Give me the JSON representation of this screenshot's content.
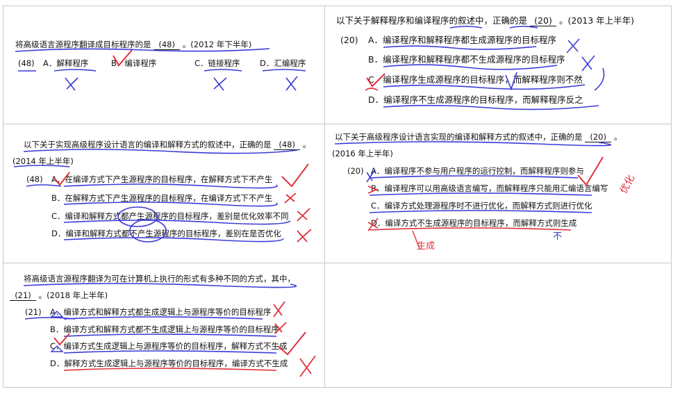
{
  "q1": {
    "stem": "将高级语言源程序翻译成目标程序的是",
    "blank": "(48)",
    "tail": "。(2012 年下半年)",
    "num": "(48)",
    "options": [
      "A．解释程序",
      "B．编译程序",
      "C．链接程序",
      "D．汇编程序"
    ]
  },
  "q2": {
    "stem": "以下关于解释程序和编译程序的叙述中，正确的是",
    "blank": "(20)",
    "tail": "。(2013 年上半年)",
    "num": "(20)",
    "options": [
      "A．编译程序和解释程序都生成源程序的目标程序",
      "B．编译程序和解释程序都不生成源程序的目标程序",
      "C．编译程序生成源程序的目标程序，而解释程序则不然",
      "D．编译程序不生成源程序的目标程序，而解释程序反之"
    ]
  },
  "q3": {
    "stem": "以下关于实现高级程序设计语言的编译和解释方式的叙述中，正确的是",
    "blank": "(48)",
    "tail": "。",
    "year": "(2014 年上半年)",
    "num": "(48)",
    "options": [
      "A．在编译方式下产生源程序的目标程序，在解释方式下不产生",
      "B．在解释方式下产生源程序的目标程序，在编译方式下不产生",
      "C．编译和解释方式都产生源程序的目标程序，差别是优化效率不同",
      "D．编译和解释方式都不产生源程序的目标程序，差别在是否优化"
    ]
  },
  "q4": {
    "stem": "以下关于高级程序设计语言实现的编译和解释方式的叙述中，正确的是",
    "blank": "(20)",
    "tail": "。",
    "year": "(2016 年上半年)",
    "num": "(20)",
    "options": [
      "A．编译程序不参与用户程序的运行控制，而解释程序则参与",
      "B．编译程序可以用高级语言编写，而解释程序只能用汇编语言编写",
      "C．编译方式处理源程序时不进行优化，而解释方式则进行优化",
      "D．编译方式不生成源程序的目标程序，而解释方式则生成"
    ],
    "notes": [
      "优化",
      "生成",
      "不"
    ]
  },
  "q5": {
    "stem": "将高级语言源程序翻译为可在计算机上执行的形式有多种不同的方式，其中，",
    "blank": "(21)",
    "tail": "。(2018 年上半年)",
    "num": "(21)",
    "options": [
      "A．编译方式和解释方式都生成逻辑上与源程序等价的目标程序",
      "B．编译方式和解释方式都不生成逻辑上与源程序等价的目标程序",
      "C．编译方式生成逻辑上与源程序等价的目标程序，解释方式不生成",
      "D．解释方式生成逻辑上与源程序等价的目标程序，编译方式不生成"
    ]
  },
  "ink": {
    "blue": "#3a3ad8",
    "red": "#e0303a"
  }
}
